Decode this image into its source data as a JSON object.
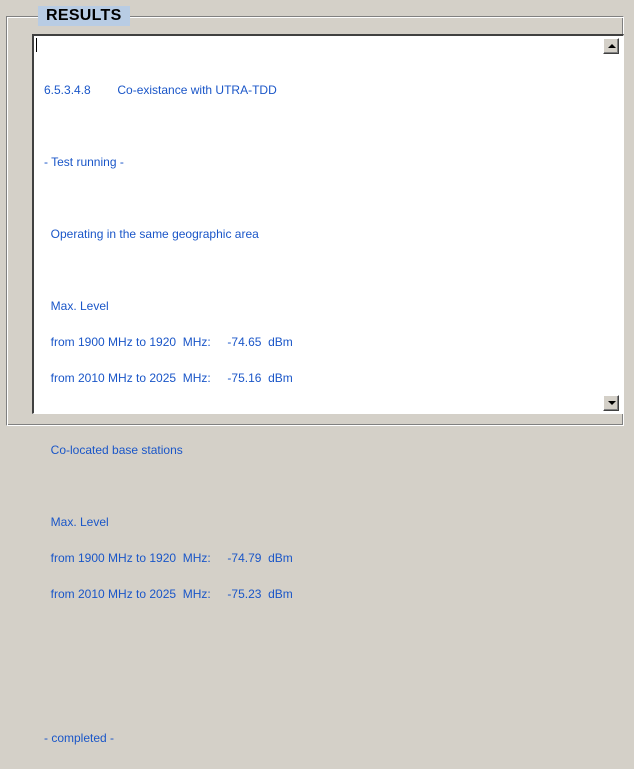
{
  "results": {
    "title": "RESULTS",
    "lines": [
      "6.5.3.4.8        Co-existance with UTRA-TDD",
      "",
      "- Test running -",
      "",
      "  Operating in the same geographic area",
      "",
      "  Max. Level",
      "  from 1900 MHz to 1920  MHz:     -74.65  dBm",
      "  from 2010 MHz to 2025  MHz:     -75.16  dBm",
      "",
      "  Co-located base stations",
      "",
      "  Max. Level",
      "  from 1900 MHz to 1920  MHz:     -74.79  dBm",
      "  from 2010 MHz to 2025  MHz:     -75.23  dBm",
      "",
      "",
      "",
      "- completed -"
    ]
  }
}
